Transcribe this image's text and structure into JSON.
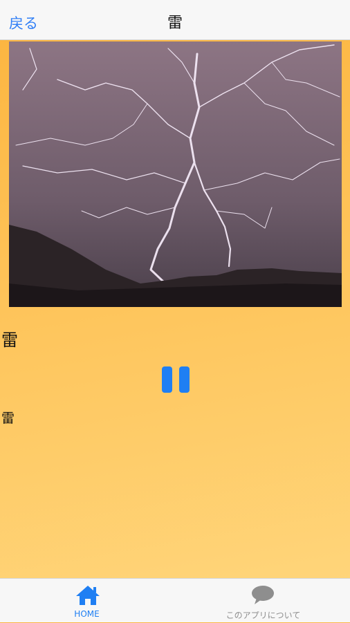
{
  "nav": {
    "back_label": "戻る",
    "title": "雷"
  },
  "content": {
    "image_icon": "lightning-photo",
    "heading": "雷",
    "playback_icon": "pause-icon",
    "description": "雷"
  },
  "tabbar": {
    "tabs": [
      {
        "label": "HOME",
        "icon": "home-icon",
        "active": true
      },
      {
        "label": "このアプリについて",
        "icon": "speech-bubble-icon",
        "active": false
      }
    ]
  },
  "colors": {
    "accent": "#1f7ff3",
    "background_top": "#fcb43e",
    "background_bottom": "#ffd77e",
    "bar": "#f7f7f7"
  }
}
